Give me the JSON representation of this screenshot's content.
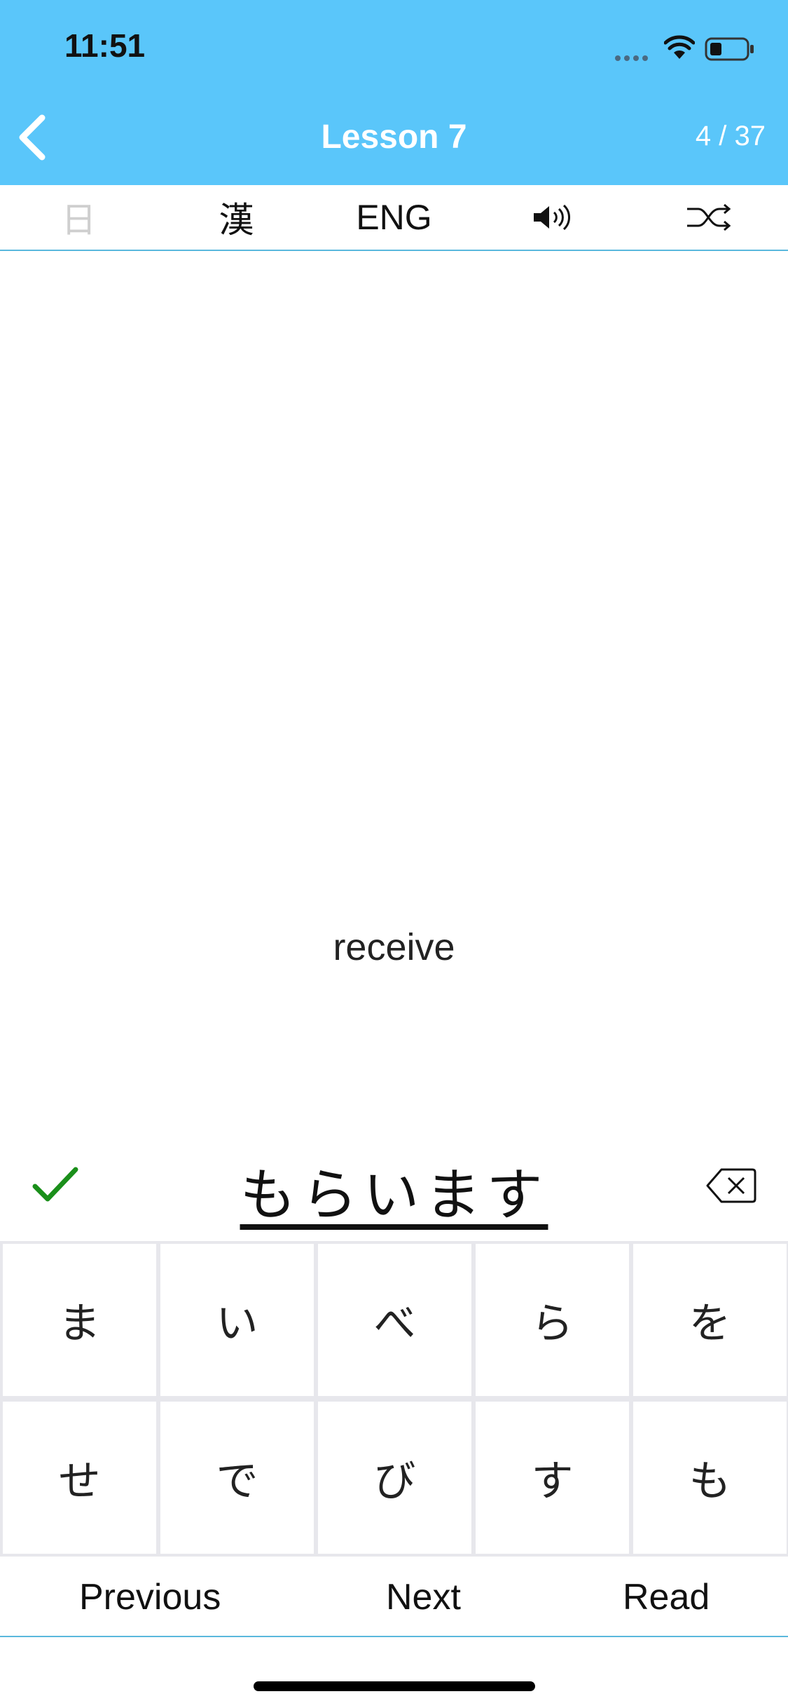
{
  "status_bar": {
    "time": "11:51"
  },
  "header": {
    "title": "Lesson 7",
    "counter": "4 / 37",
    "background": "#5ac6fa"
  },
  "toolbar": {
    "japanese_toggle": "日",
    "kanji_toggle": "漢",
    "english_toggle": "ENG",
    "icons": [
      "speaker-icon",
      "shuffle-icon"
    ]
  },
  "card": {
    "prompt": "receive"
  },
  "answer": {
    "text": "もらいます"
  },
  "keyboard": {
    "row1": [
      "ま",
      "い",
      "べ",
      "ら",
      "を"
    ],
    "row2": [
      "せ",
      "で",
      "び",
      "す",
      "も"
    ]
  },
  "nav": {
    "previous": "Previous",
    "next": "Next",
    "read": "Read"
  },
  "colors": {
    "accent": "#5ac6fa",
    "check": "#1a8f1a",
    "divider": "#5ab8dd"
  }
}
